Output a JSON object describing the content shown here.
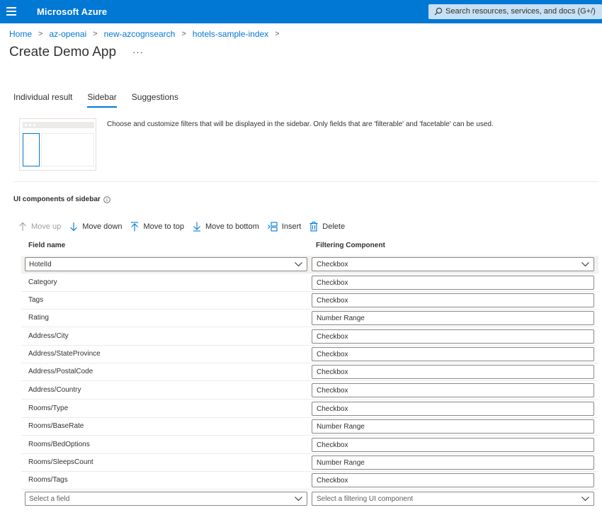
{
  "app": {
    "brand": "Microsoft Azure",
    "search_placeholder": "Search resources, services, and docs (G+/)"
  },
  "breadcrumb": [
    "Home",
    "az-openai",
    "new-azcognsearch",
    "hotels-sample-index"
  ],
  "page": {
    "title": "Create Demo App",
    "more": "···"
  },
  "tabs": [
    {
      "label": "Individual result",
      "active": false
    },
    {
      "label": "Sidebar",
      "active": true
    },
    {
      "label": "Suggestions",
      "active": false
    }
  ],
  "description": "Choose and customize filters that will be displayed in the sidebar. Only fields that are 'filterable' and 'facetable' can be used.",
  "section_title": "UI components of sidebar",
  "toolbar": {
    "move_up": "Move up",
    "move_down": "Move down",
    "move_to_top": "Move to top",
    "move_to_bottom": "Move to bottom",
    "insert": "Insert",
    "delete": "Delete"
  },
  "table": {
    "headers": {
      "field": "Field name",
      "component": "Filtering Component"
    },
    "rows": [
      {
        "field": "HotelId",
        "component": "Checkbox",
        "selected": true
      },
      {
        "field": "Category",
        "component": "Checkbox"
      },
      {
        "field": "Tags",
        "component": "Checkbox"
      },
      {
        "field": "Rating",
        "component": "Number Range"
      },
      {
        "field": "Address/City",
        "component": "Checkbox"
      },
      {
        "field": "Address/StateProvince",
        "component": "Checkbox"
      },
      {
        "field": "Address/PostalCode",
        "component": "Checkbox"
      },
      {
        "field": "Address/Country",
        "component": "Checkbox"
      },
      {
        "field": "Rooms/Type",
        "component": "Checkbox"
      },
      {
        "field": "Rooms/BaseRate",
        "component": "Number Range"
      },
      {
        "field": "Rooms/BedOptions",
        "component": "Checkbox"
      },
      {
        "field": "Rooms/SleepsCount",
        "component": "Number Range"
      },
      {
        "field": "Rooms/Tags",
        "component": "Checkbox"
      }
    ],
    "new_row": {
      "field_placeholder": "Select a field",
      "component_placeholder": "Select a filtering UI component"
    }
  },
  "colors": {
    "accent": "#0078d4",
    "search_bg": "#c7e0f4"
  }
}
